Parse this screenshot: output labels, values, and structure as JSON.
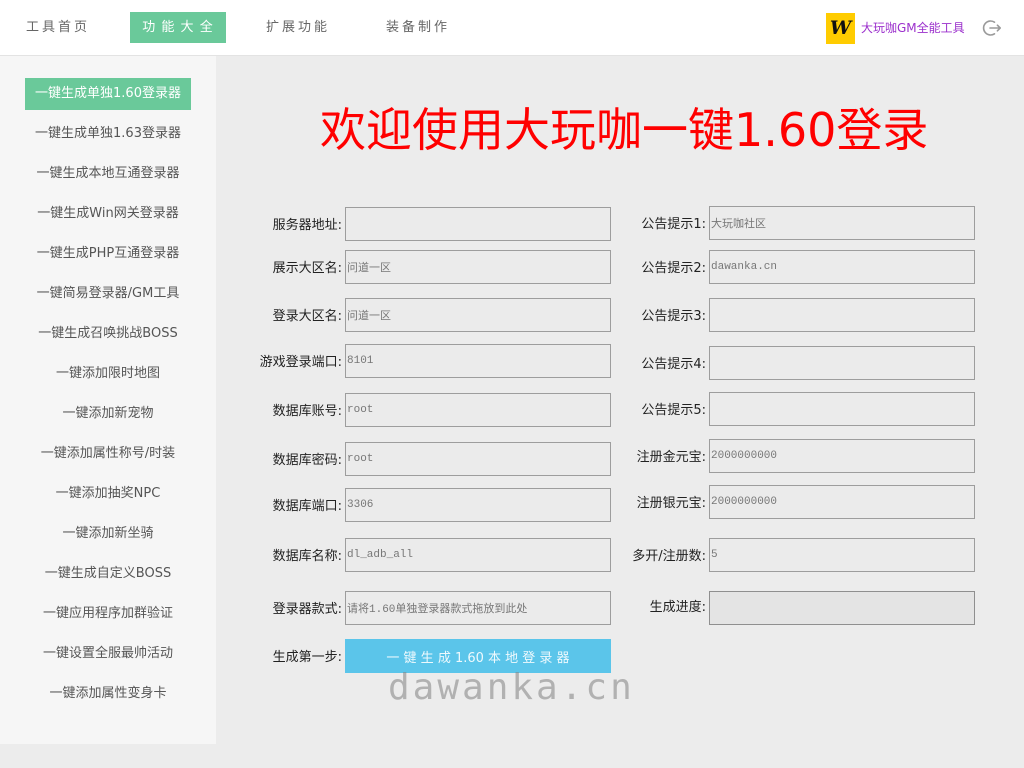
{
  "colors": {
    "accent_green": "#6ac99a",
    "title_red": "#ff0000",
    "button_blue": "#5bc5ea",
    "brand_purple": "#9b2fcc",
    "logo_yellow": "#ffcc00"
  },
  "header": {
    "tabs": [
      {
        "label": "工具首页",
        "active": false
      },
      {
        "label": "功 能 大 全",
        "active": true
      },
      {
        "label": "扩展功能",
        "active": false
      },
      {
        "label": "装备制作",
        "active": false
      }
    ],
    "brand": {
      "logo_icon": "dawanka-logo-icon",
      "logo_letter": "W",
      "name": "大玩咖GM全能工具"
    },
    "logout_icon": "logout-icon"
  },
  "sidebar": {
    "items": [
      {
        "label": "一键生成单独1.60登录器",
        "active": true
      },
      {
        "label": "一键生成单独1.63登录器",
        "active": false
      },
      {
        "label": "一键生成本地互通登录器",
        "active": false
      },
      {
        "label": "一键生成Win网关登录器",
        "active": false
      },
      {
        "label": "一键生成PHP互通登录器",
        "active": false
      },
      {
        "label": "一键简易登录器/GM工具",
        "active": false
      },
      {
        "label": "一键生成召唤挑战BOSS",
        "active": false
      },
      {
        "label": "一键添加限时地图",
        "active": false
      },
      {
        "label": "一键添加新宠物",
        "active": false
      },
      {
        "label": "一键添加属性称号/时装",
        "active": false
      },
      {
        "label": "一键添加抽奖NPC",
        "active": false
      },
      {
        "label": "一键添加新坐骑",
        "active": false
      },
      {
        "label": "一键生成自定义BOSS",
        "active": false
      },
      {
        "label": "一键应用程序加群验证",
        "active": false
      },
      {
        "label": "一键设置全服最帅活动",
        "active": false
      },
      {
        "label": "一键添加属性变身卡",
        "active": false
      }
    ]
  },
  "main": {
    "title": "欢迎使用大玩咖一键1.60登录",
    "form": {
      "left": [
        {
          "label": "服务器地址:",
          "value": ""
        },
        {
          "label": "展示大区名:",
          "value": "问道一区"
        },
        {
          "label": "登录大区名:",
          "value": "问道一区"
        },
        {
          "label": "游戏登录端口:",
          "value": "8101"
        },
        {
          "label": "数据库账号:",
          "value": "root"
        },
        {
          "label": "数据库密码:",
          "value": "root"
        },
        {
          "label": "数据库端口:",
          "value": "3306"
        },
        {
          "label": "数据库名称:",
          "value": "dl_adb_all"
        },
        {
          "label": "登录器款式:",
          "value": "请将1.60单独登录器款式拖放到此处"
        }
      ],
      "right": [
        {
          "label": "公告提示1:",
          "value": "大玩咖社区"
        },
        {
          "label": "公告提示2:",
          "value": "dawanka.cn"
        },
        {
          "label": "公告提示3:",
          "value": ""
        },
        {
          "label": "公告提示4:",
          "value": ""
        },
        {
          "label": "公告提示5:",
          "value": ""
        },
        {
          "label": "注册金元宝:",
          "value": "2000000000"
        },
        {
          "label": "注册银元宝:",
          "value": "2000000000"
        },
        {
          "label": "多开/注册数:",
          "value": "5"
        }
      ],
      "generate": {
        "label": "生成第一步:",
        "button": "一 键 生 成 1.60 本 地 登 录 器"
      },
      "progress": {
        "label": "生成进度:",
        "percent": 0
      }
    },
    "watermark": "dawanka.cn"
  }
}
